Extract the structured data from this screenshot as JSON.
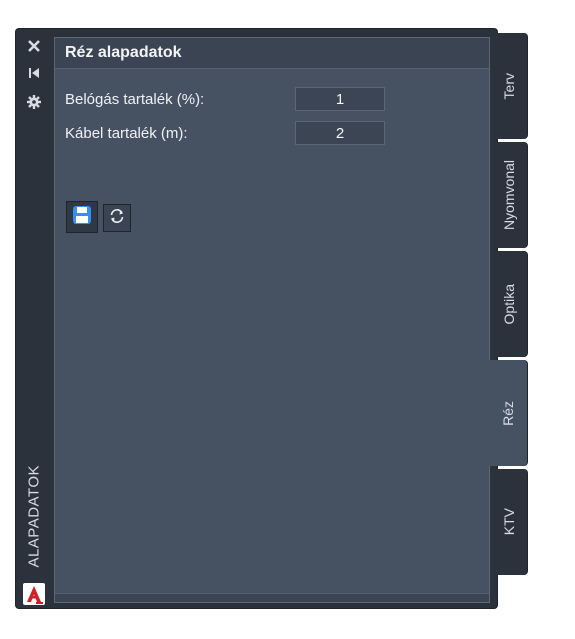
{
  "panel": {
    "vertical_title": "ALAPADATOK",
    "header_title": "Réz alapadatok",
    "fields": [
      {
        "label": "Belógás tartalék (%):",
        "value": "1"
      },
      {
        "label": "Kábel tartalék (m):",
        "value": "2"
      }
    ],
    "toolbar": {
      "save_icon": "save-icon",
      "refresh_icon": "refresh-icon"
    },
    "strip_icons": [
      "close-icon",
      "auto-hide-icon",
      "settings-icon"
    ],
    "logo_letter": "A"
  },
  "tabs": [
    {
      "label": "Terv",
      "active": false
    },
    {
      "label": "Nyomvonal",
      "active": false
    },
    {
      "label": "Optika",
      "active": false
    },
    {
      "label": "Réz",
      "active": true
    },
    {
      "label": "KTV",
      "active": false
    }
  ],
  "colors": {
    "panel_bg": "#465262",
    "chrome_bg": "#2c323c",
    "accent_save": "#3d8ee8",
    "logo_red": "#d21f26"
  }
}
